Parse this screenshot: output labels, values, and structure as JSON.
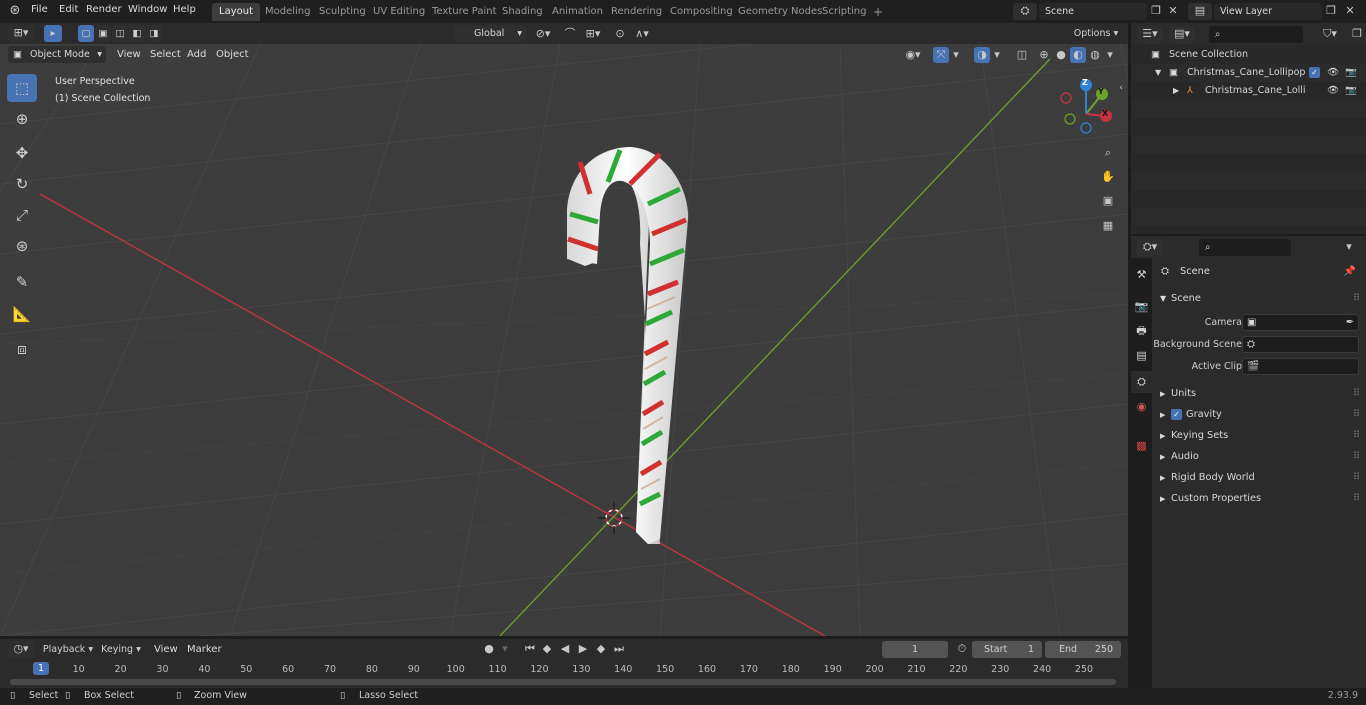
{
  "topbar": {
    "menus": [
      "File",
      "Edit",
      "Render",
      "Window",
      "Help"
    ],
    "workspaces": [
      "Layout",
      "Modeling",
      "Sculpting",
      "UV Editing",
      "Texture Paint",
      "Shading",
      "Animation",
      "Rendering",
      "Compositing",
      "Geometry Nodes",
      "Scripting"
    ],
    "active_workspace": "Layout",
    "add_tab": "+",
    "scene_name": "Scene",
    "view_layer_name": "View Layer"
  },
  "viewport_header": {
    "mode": "Object Mode",
    "menus": [
      "View",
      "Select",
      "Add",
      "Object"
    ],
    "transform_orientation": "Global",
    "options_label": "Options"
  },
  "viewport": {
    "perspective_label": "User Perspective",
    "collection_label": "(1) Scene Collection",
    "gizmo_axes": [
      "X",
      "Y",
      "Z"
    ],
    "colors": {
      "x_axis": "#c8323f",
      "y_axis": "#6ea22a",
      "z_axis": "#2f83d6",
      "accent": "#4772b3"
    }
  },
  "outliner": {
    "root": "Scene Collection",
    "items": [
      {
        "label": "Christmas_Cane_Lollipop_Re"
      },
      {
        "label": "Christmas_Cane_Lollipop"
      }
    ]
  },
  "properties": {
    "context_title": "Scene",
    "section": "Scene",
    "fields": [
      {
        "label": "Camera"
      },
      {
        "label": "Background Scene"
      },
      {
        "label": "Active Clip"
      }
    ],
    "panels": [
      "Units",
      "Gravity",
      "Keying Sets",
      "Audio",
      "Rigid Body World",
      "Custom Properties"
    ]
  },
  "timeline": {
    "menus": [
      "Playback",
      "Keying",
      "View",
      "Marker"
    ],
    "current_frame": "1",
    "start_label": "Start",
    "start_value": "1",
    "end_label": "End",
    "end_value": "250",
    "ticks": [
      "1",
      "10",
      "20",
      "30",
      "40",
      "50",
      "60",
      "70",
      "80",
      "90",
      "100",
      "110",
      "120",
      "130",
      "140",
      "150",
      "160",
      "170",
      "180",
      "190",
      "200",
      "210",
      "220",
      "230",
      "240",
      "250"
    ]
  },
  "statusbar": {
    "items": [
      "Select",
      "Box Select",
      "Zoom View",
      "Lasso Select"
    ],
    "version": "2.93.9"
  }
}
